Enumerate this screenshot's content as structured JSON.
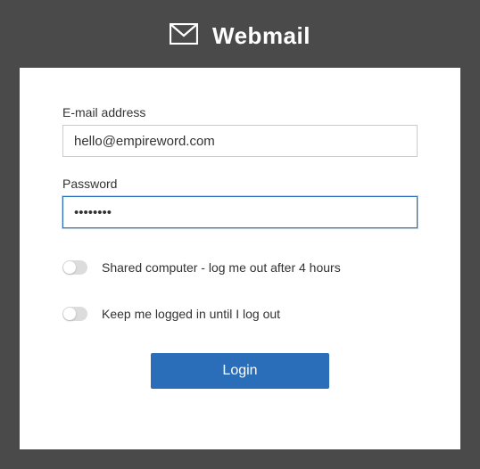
{
  "header": {
    "title": "Webmail"
  },
  "form": {
    "email": {
      "label": "E-mail address",
      "value": "hello@empireword.com"
    },
    "password": {
      "label": "Password",
      "value": "••••••••"
    },
    "toggles": {
      "shared": {
        "label": "Shared computer - log me out after 4 hours",
        "checked": false
      },
      "keep": {
        "label": "Keep me logged in until I log out",
        "checked": false
      }
    },
    "login_label": "Login"
  }
}
